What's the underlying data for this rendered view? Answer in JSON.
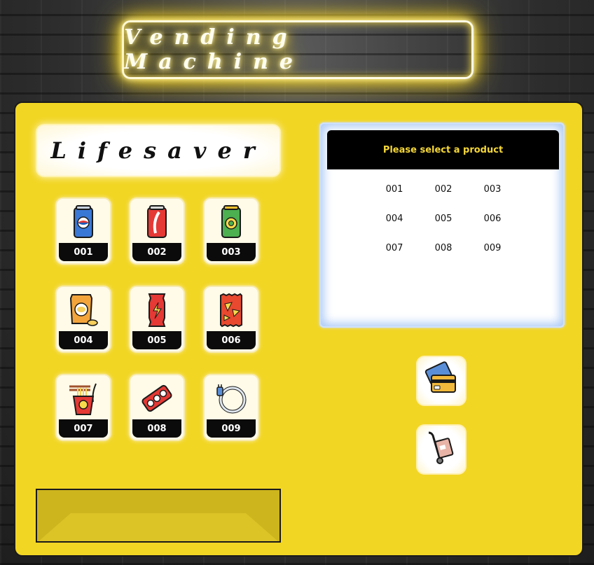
{
  "header": {
    "title": "Vending Machine"
  },
  "brand": {
    "name": "Lifesaver"
  },
  "products": [
    {
      "code": "001",
      "icon": "soda-can-blue-icon"
    },
    {
      "code": "002",
      "icon": "soda-can-red-icon"
    },
    {
      "code": "003",
      "icon": "soda-can-green-icon"
    },
    {
      "code": "004",
      "icon": "chips-bag-icon"
    },
    {
      "code": "005",
      "icon": "snack-bar-icon"
    },
    {
      "code": "006",
      "icon": "nachos-bag-icon"
    },
    {
      "code": "007",
      "icon": "noodle-cup-icon"
    },
    {
      "code": "008",
      "icon": "sushi-tray-icon"
    },
    {
      "code": "009",
      "icon": "charging-cable-icon"
    }
  ],
  "screen": {
    "message": "Please select a product",
    "codes": [
      "001",
      "002",
      "003",
      "004",
      "005",
      "006",
      "007",
      "008",
      "009"
    ]
  },
  "actions": {
    "payment_icon": "credit-card-icon",
    "delivery_icon": "hand-truck-icon"
  },
  "colors": {
    "machine": "#f2d624",
    "neon_glow": "#ffe34d",
    "screen_message_text": "#f5d738"
  }
}
